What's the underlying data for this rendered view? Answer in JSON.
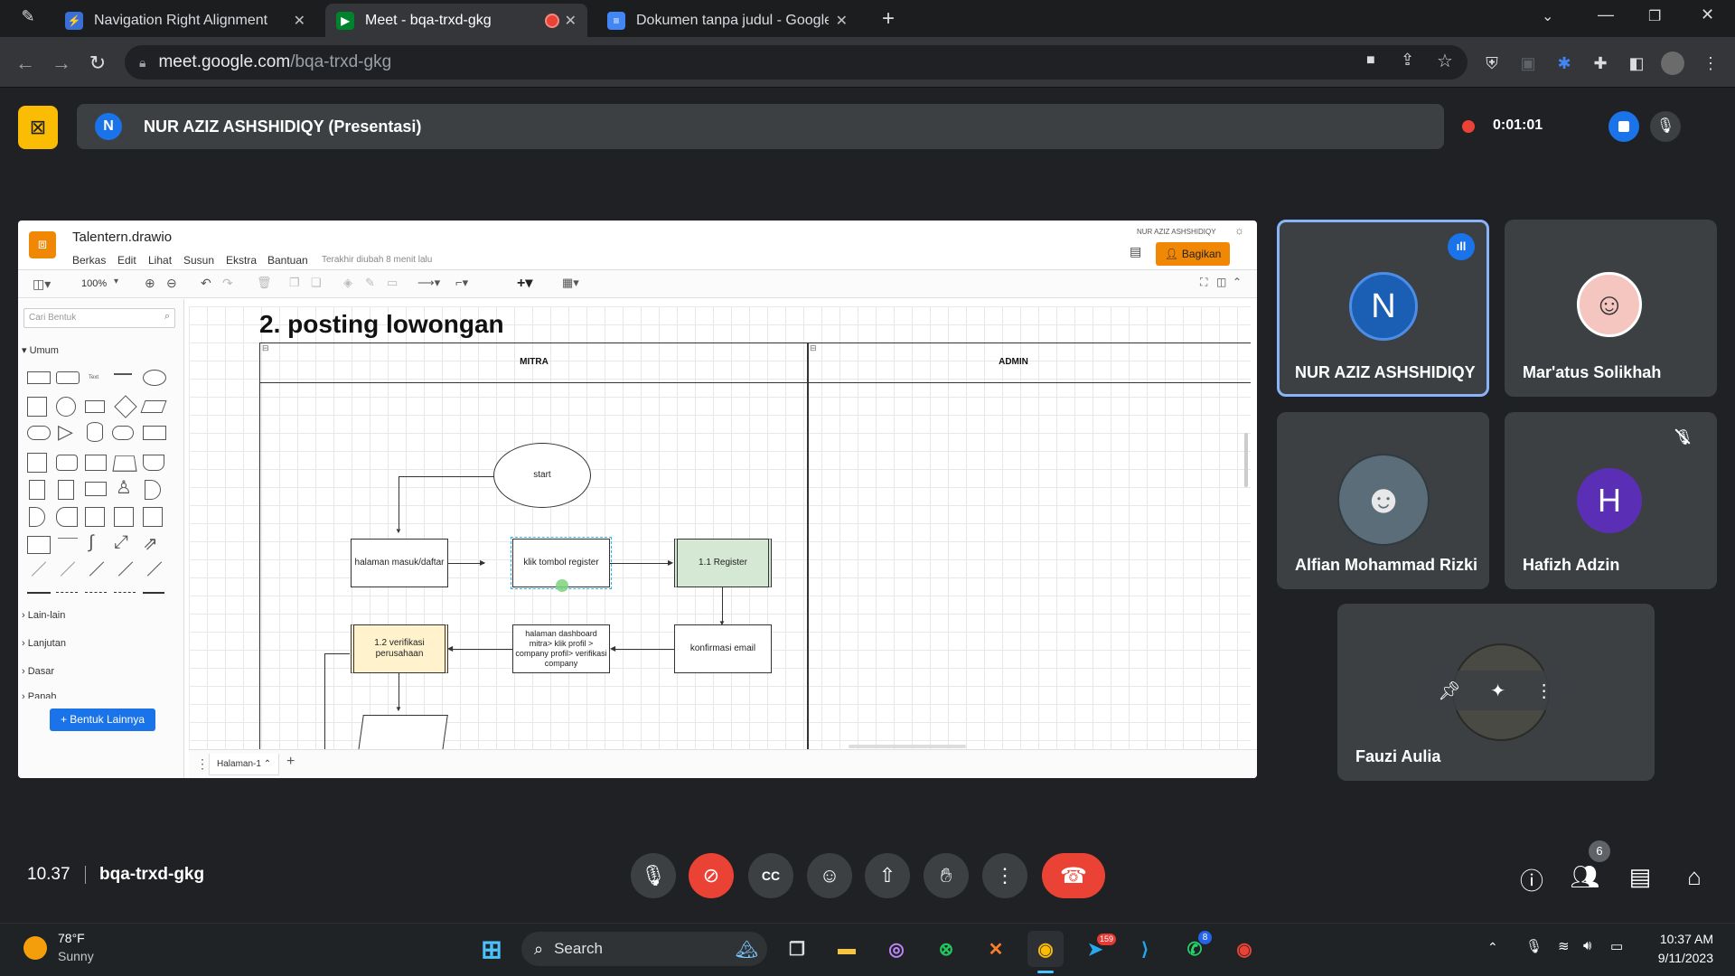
{
  "browser": {
    "tabs": [
      {
        "title": "Navigation Right Alignment",
        "active": false
      },
      {
        "title": "Meet - bqa-trxd-gkg",
        "active": true
      },
      {
        "title": "Dokumen tanpa judul - Google D",
        "active": false
      }
    ],
    "url_host": "meet.google.com",
    "url_path": "/bqa-trxd-gkg"
  },
  "presentation": {
    "avatar_letter": "N",
    "title": "NUR AZIZ ASHSHIDIQY (Presentasi)",
    "recording_time": "0:01:01"
  },
  "drawio": {
    "filename": "Talentern.drawio",
    "menu": [
      "Berkas",
      "Edit",
      "Lihat",
      "Susun",
      "Ekstra",
      "Bantuan"
    ],
    "last_edit": "Terakhir diubah 8 menit lalu",
    "user": "NUR AZIZ ASHSHIDIQY",
    "share_label": "Bagikan",
    "zoom": "100%",
    "search_placeholder": "Cari Bentuk",
    "section_general": "Umum",
    "sections": [
      "Lain-lain",
      "Lanjutan",
      "Dasar",
      "Panah"
    ],
    "more_shapes": "+ Bentuk Lainnya",
    "page_tab": "Halaman-1",
    "diagram": {
      "heading": "2. posting lowongan",
      "lane_left": "MITRA",
      "lane_right": "ADMIN",
      "start": "start",
      "halaman_masuk": "halaman masuk/daftar",
      "klik_register": "klik tombol register",
      "register": "1.1 Register",
      "verifikasi": "1.2 verifikasi perusahaan",
      "dashboard": "halaman dashboard mitra> klik profil > company profil> verifikasi company",
      "konfirmasi": "konfirmasi email"
    }
  },
  "participants": [
    {
      "name": "NUR AZIZ ASHSHIDIQY",
      "letter": "N",
      "color": "#1a5fb4",
      "speaking": true
    },
    {
      "name": "Mar'atus Solikhah",
      "letter": "",
      "color": "#f5c6c0"
    },
    {
      "name": "Alfian Mohammad Rizki",
      "letter": "",
      "color": "#5a6d78"
    },
    {
      "name": "Hafizh Adzin",
      "letter": "H",
      "color": "#5b2fb5",
      "muted": true
    },
    {
      "name": "Fauzi Aulia",
      "letter": "",
      "color": "#4a4a44"
    }
  ],
  "bottom": {
    "time": "10.37",
    "meeting_code": "bqa-trxd-gkg",
    "people_count": "6"
  },
  "taskbar": {
    "weather_temp": "78°F",
    "weather_desc": "Sunny",
    "search_label": "Search",
    "telegram_badge": "159",
    "whatsapp_badge": "8",
    "clock_time": "10:37 AM",
    "clock_date": "9/11/2023"
  },
  "colors": {
    "meet_bg": "#202124",
    "tile_bg": "#3c4043",
    "accent_blue": "#1a73e8",
    "hangup_red": "#ea4335",
    "present_yellow": "#fbbc04",
    "drawio_orange": "#f08705"
  }
}
